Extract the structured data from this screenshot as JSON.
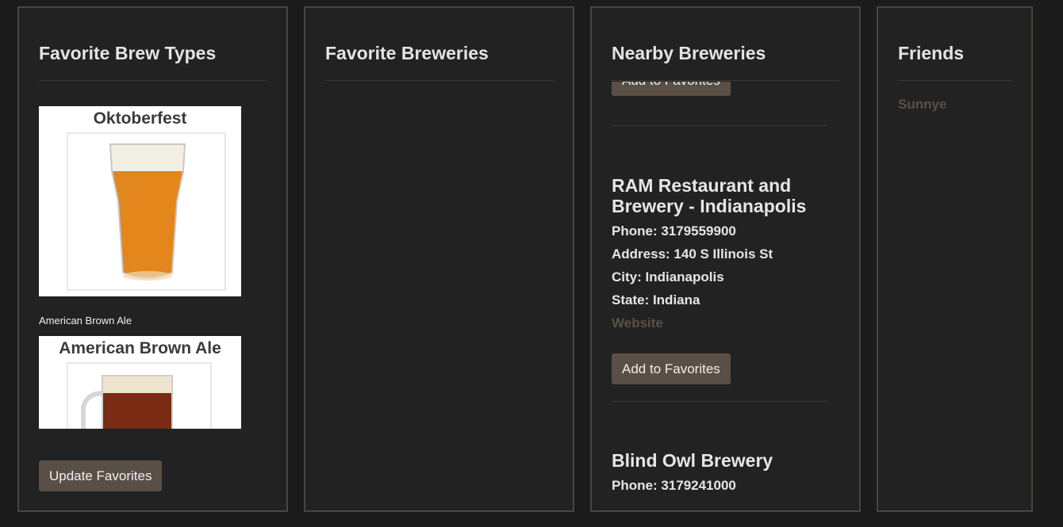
{
  "brew_types_panel": {
    "title": "Favorite Brew Types",
    "cards": [
      {
        "title": "Oktoberfest",
        "beer_color": "#e0861a"
      },
      {
        "title": "American Brown Ale",
        "caption": "American Brown Ale",
        "beer_color": "#7a2d14"
      }
    ],
    "update_button": "Update Favorites"
  },
  "favorite_breweries_panel": {
    "title": "Favorite Breweries"
  },
  "nearby_panel": {
    "title": "Nearby Breweries",
    "partial_button": "Add to Favorites",
    "breweries": [
      {
        "name": "RAM Restaurant and Brewery - Indianapolis",
        "phone": "Phone: 3179559900",
        "address": "Address: 140 S Illinois St",
        "city": "City: Indianapolis",
        "state": "State: Indiana",
        "website": "Website",
        "add_button": "Add to Favorites"
      },
      {
        "name": "Blind Owl Brewery",
        "phone": "Phone: 3179241000"
      }
    ]
  },
  "friends_panel": {
    "title": "Friends",
    "friends": [
      "Sunnye"
    ]
  },
  "colors": {
    "background": "#1b1b1b",
    "panel": "#222222",
    "border": "#4a443e",
    "button": "#5a4f46",
    "link": "#5a5048"
  }
}
